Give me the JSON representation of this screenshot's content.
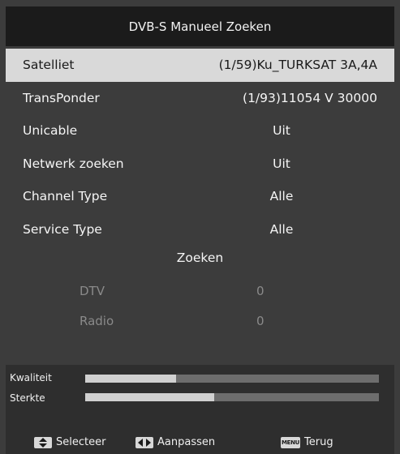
{
  "title": "DVB-S Manueel Zoeken",
  "rows": [
    {
      "label": "Satelliet",
      "value": "(1/59)Ku_TURKSAT 3A,4A"
    },
    {
      "label": "TransPonder",
      "value": "(1/93)11054 V 30000"
    },
    {
      "label": "Unicable",
      "value": "Uit"
    },
    {
      "label": "Netwerk zoeken",
      "value": "Uit"
    },
    {
      "label": "Channel Type",
      "value": "Alle"
    },
    {
      "label": "Service Type",
      "value": "Alle"
    }
  ],
  "search_label": "Zoeken",
  "results": [
    {
      "label": "DTV",
      "count": "0"
    },
    {
      "label": "Radio",
      "count": "0"
    }
  ],
  "signal": {
    "quality_label": "Kwaliteit",
    "quality_fraction": 0.31,
    "strength_label": "Sterkte",
    "strength_fraction": 0.44
  },
  "hints": [
    {
      "icon": "up-down-arrows-icon",
      "label": "Selecteer"
    },
    {
      "icon": "left-right-arrows-icon",
      "label": "Aanpassen"
    },
    {
      "icon": "MENU",
      "label": "Terug"
    }
  ]
}
